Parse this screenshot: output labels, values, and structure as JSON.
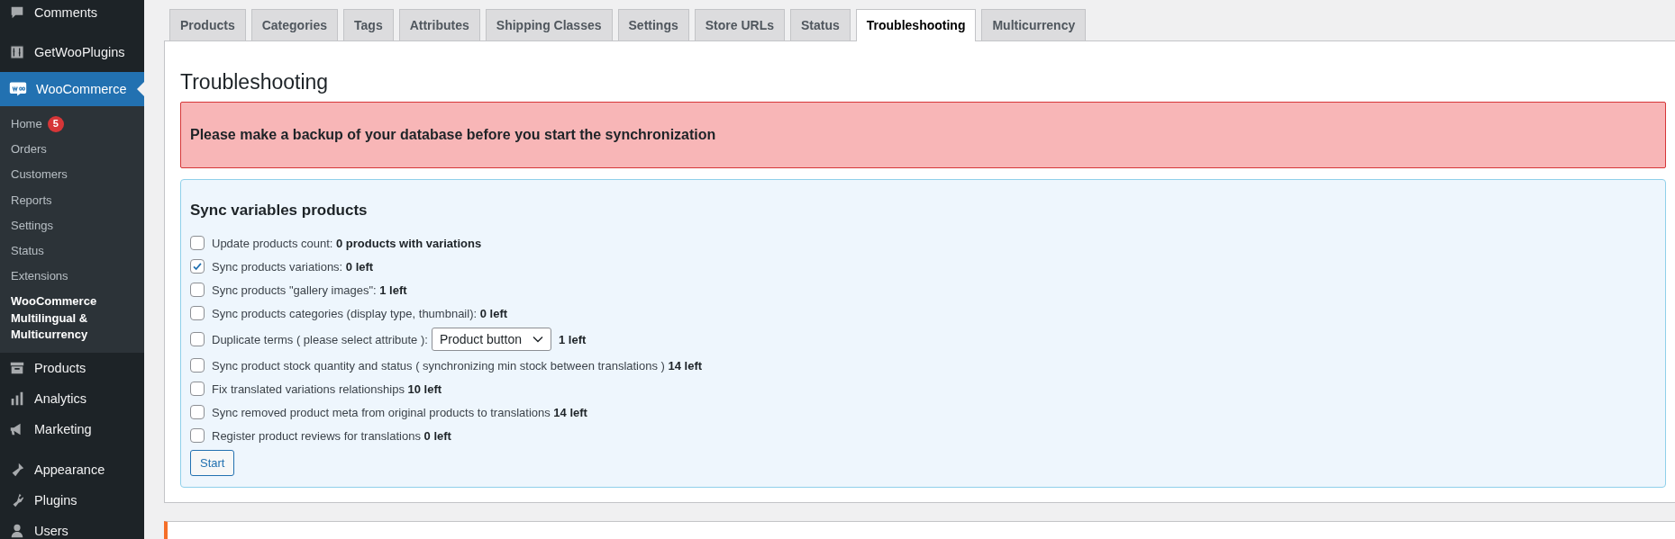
{
  "sidebar": {
    "items": [
      {
        "label": "Comments",
        "selected": false
      },
      {
        "label": "GetWooPlugins",
        "selected": false
      },
      {
        "label": "WooCommerce",
        "selected": true,
        "children": [
          {
            "label": "Home",
            "selected": false,
            "badge": "5"
          },
          {
            "label": "Orders",
            "selected": false
          },
          {
            "label": "Customers",
            "selected": false
          },
          {
            "label": "Reports",
            "selected": false
          },
          {
            "label": "Settings",
            "selected": false
          },
          {
            "label": "Status",
            "selected": false
          },
          {
            "label": "Extensions",
            "selected": false
          },
          {
            "label": "WooCommerce Multilingual & Multicurrency",
            "selected": true
          }
        ]
      },
      {
        "label": "Products",
        "selected": false
      },
      {
        "label": "Analytics",
        "selected": false
      },
      {
        "label": "Marketing",
        "selected": false
      },
      {
        "label": "Appearance",
        "selected": false
      },
      {
        "label": "Plugins",
        "selected": false
      },
      {
        "label": "Users",
        "selected": false
      }
    ]
  },
  "tabs": [
    {
      "label": "Products",
      "selected": false
    },
    {
      "label": "Categories",
      "selected": false
    },
    {
      "label": "Tags",
      "selected": false
    },
    {
      "label": "Attributes",
      "selected": false
    },
    {
      "label": "Shipping Classes",
      "selected": false
    },
    {
      "label": "Settings",
      "selected": false
    },
    {
      "label": "Store URLs",
      "selected": false
    },
    {
      "label": "Status",
      "selected": false
    },
    {
      "label": "Troubleshooting",
      "selected": true
    },
    {
      "label": "Multicurrency",
      "selected": false
    }
  ],
  "page_title": "Troubleshooting",
  "warning": "Please make a backup of your database before you start the synchronization",
  "sync": {
    "heading": "Sync variables products",
    "options": [
      {
        "kind": "plain",
        "checked": false,
        "label": "Update products count: **0  products with variations**"
      },
      {
        "kind": "plain",
        "checked": true,
        "label": "Sync products variations: **0  left**"
      },
      {
        "kind": "plain",
        "checked": false,
        "label": "Sync products \"gallery images\": **1  left**"
      },
      {
        "kind": "plain",
        "checked": false,
        "label": "Sync products categories (display type, thumbnail): **0  left**"
      },
      {
        "kind": "select",
        "checked": false,
        "label": "Duplicate terms ( please select attribute ):",
        "select_value": "Product button",
        "after": "1  left"
      },
      {
        "kind": "plain",
        "checked": false,
        "label": "Sync product stock quantity and status ( synchronizing min stock between translations ) **14 left**"
      },
      {
        "kind": "plain",
        "checked": false,
        "label": "Fix translated variations relationships **10 left**"
      },
      {
        "kind": "plain",
        "checked": false,
        "label": "Sync removed product meta from original products to translations **14 left**"
      },
      {
        "kind": "plain",
        "checked": false,
        "label": "Register product reviews for translations **0 left**"
      }
    ],
    "button": "Start"
  }
}
